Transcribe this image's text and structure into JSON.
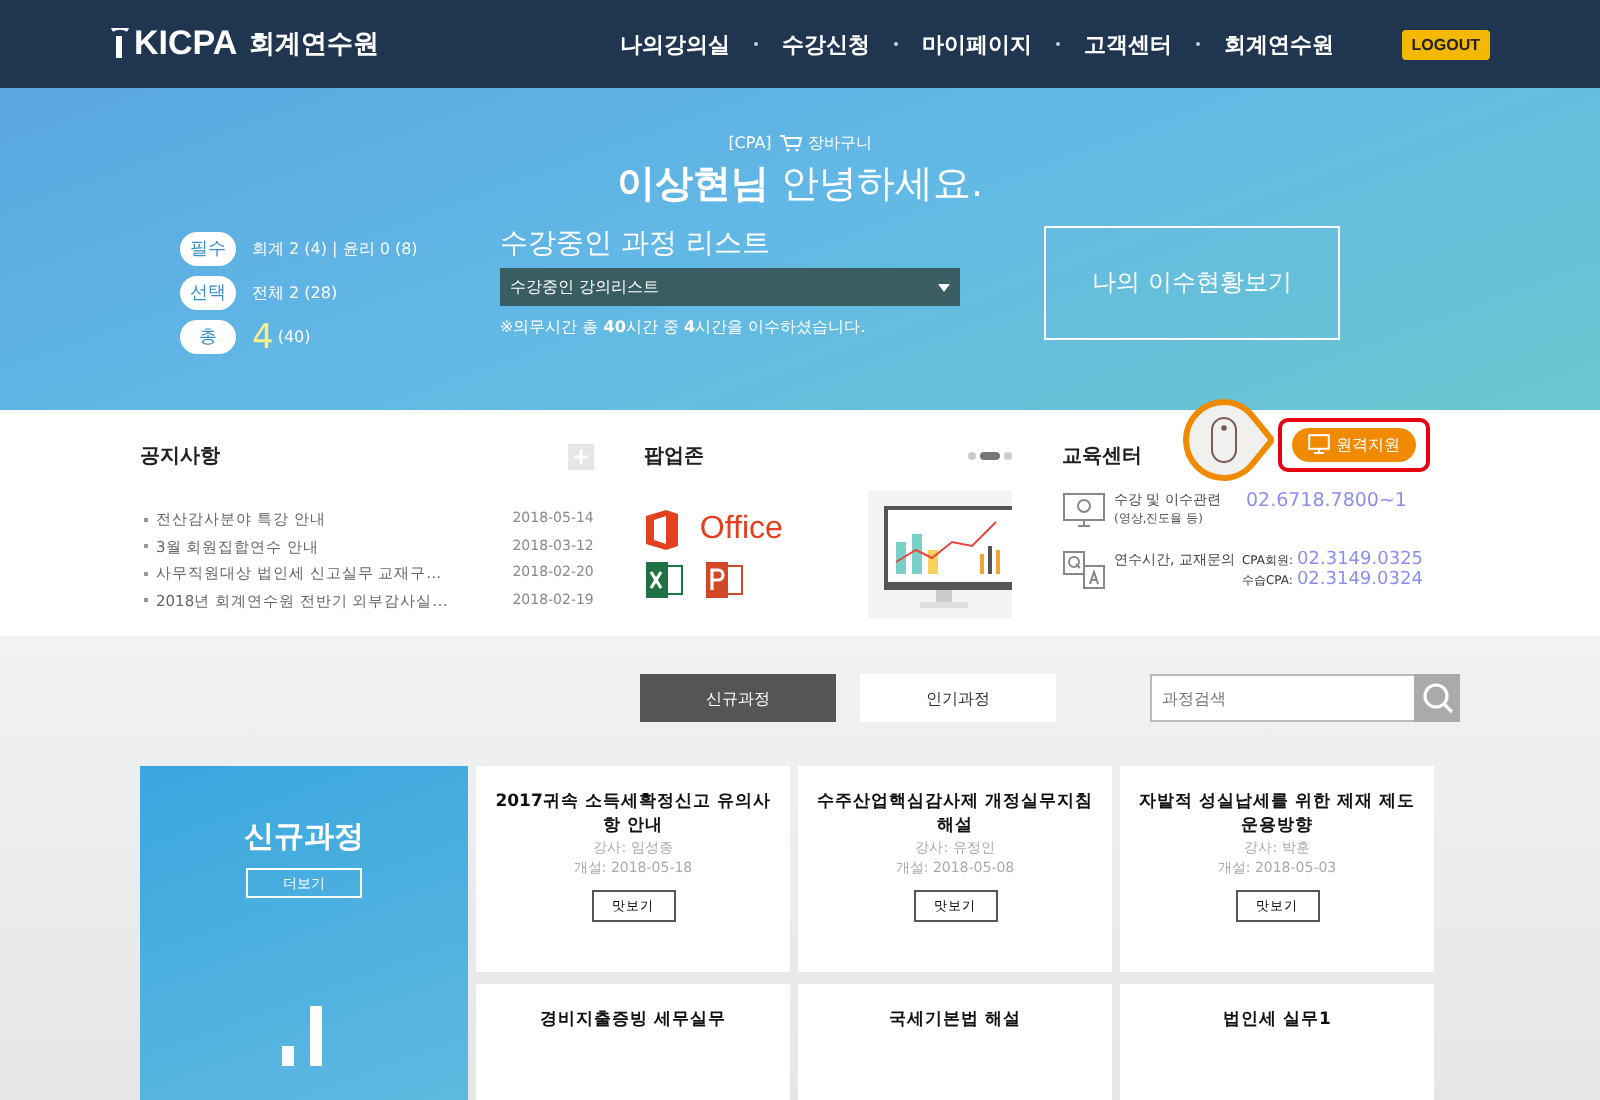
{
  "header": {
    "logo": "KICPA",
    "logo_sub": "회계연수원",
    "nav": [
      "나의강의실",
      "수강신청",
      "마이페이지",
      "고객센터",
      "회계연수원"
    ],
    "logout": "LOGOUT"
  },
  "hero": {
    "tag": "[CPA]",
    "cart": "장바구니",
    "greeting": "**이상현님** 안녕하세요.",
    "stats": [
      {
        "label": "필수",
        "text": "회계 2 (4) | 윤리 0 (8)"
      },
      {
        "label": "선택",
        "text": "전체 2 (28)"
      },
      {
        "label": "총",
        "value": "4",
        "text": "(40)"
      }
    ],
    "list_title": "수강중인 과정 리스트",
    "select_value": "수강중인 강의리스트",
    "note": "※의무시간 총 **40**시간 중 **4**시간을 이수하셨습니다.",
    "status_button": "나의 이수현황보기"
  },
  "notice": {
    "title": "공지사항",
    "items": [
      {
        "text": "전산감사분야 특강 안내",
        "date": "2018-05-14"
      },
      {
        "text": "3월 회원집합연수 안내",
        "date": "2018-03-12"
      },
      {
        "text": "사무직원대상 법인세 신고실무 교재구…",
        "date": "2018-02-20"
      },
      {
        "text": "2018년 회계연수원 전반기 외부감사실…",
        "date": "2018-02-19"
      }
    ]
  },
  "popup": {
    "title": "팝업존",
    "indicators": [
      {
        "selected": false
      },
      {
        "selected": true
      },
      {
        "selected": false
      }
    ],
    "office_label": "Office"
  },
  "edu": {
    "title": "교육센터",
    "remote_button": "원격지원",
    "contacts": [
      {
        "kind": "single",
        "label": "수강 및 이수관련",
        "sub": "(영상,진도율 등)",
        "phones": [
          {
            "number": "02.6718.7800~1"
          }
        ]
      },
      {
        "kind": "double",
        "label": "연수시간, 교재문의",
        "phones": [
          {
            "prefix": "CPA회원:",
            "number": "02.3149.0325"
          },
          {
            "prefix": "수습CPA:",
            "number": "02.3149.0324"
          }
        ]
      }
    ]
  },
  "courses": {
    "tabs": [
      {
        "label": "신규과정",
        "selected": true
      },
      {
        "label": "인기과정",
        "selected": false
      }
    ],
    "search": {
      "placeholder": "과정검색"
    },
    "feature": {
      "title": "신규과정",
      "more": "더보기"
    },
    "cards": [
      {
        "title": "2017귀속 소득세확정신고 유의사항 안내",
        "instructor": "강사: 임성종",
        "date": "개설: 2018-05-18",
        "button": "맛보기"
      },
      {
        "title": "수주산업핵심감사제 개정실무지침 해설",
        "instructor": "강사: 유정인",
        "date": "개설: 2018-05-08",
        "button": "맛보기"
      },
      {
        "title": "자발적 성실납세를 위한 제재 제도 운용방향",
        "instructor": "강사: 박훈",
        "date": "개설: 2018-05-03",
        "button": "맛보기"
      },
      {
        "title": "경비지출증빙 세무실무"
      },
      {
        "title": "국세기본법 해설"
      },
      {
        "title": "법인세 실무1"
      }
    ]
  }
}
